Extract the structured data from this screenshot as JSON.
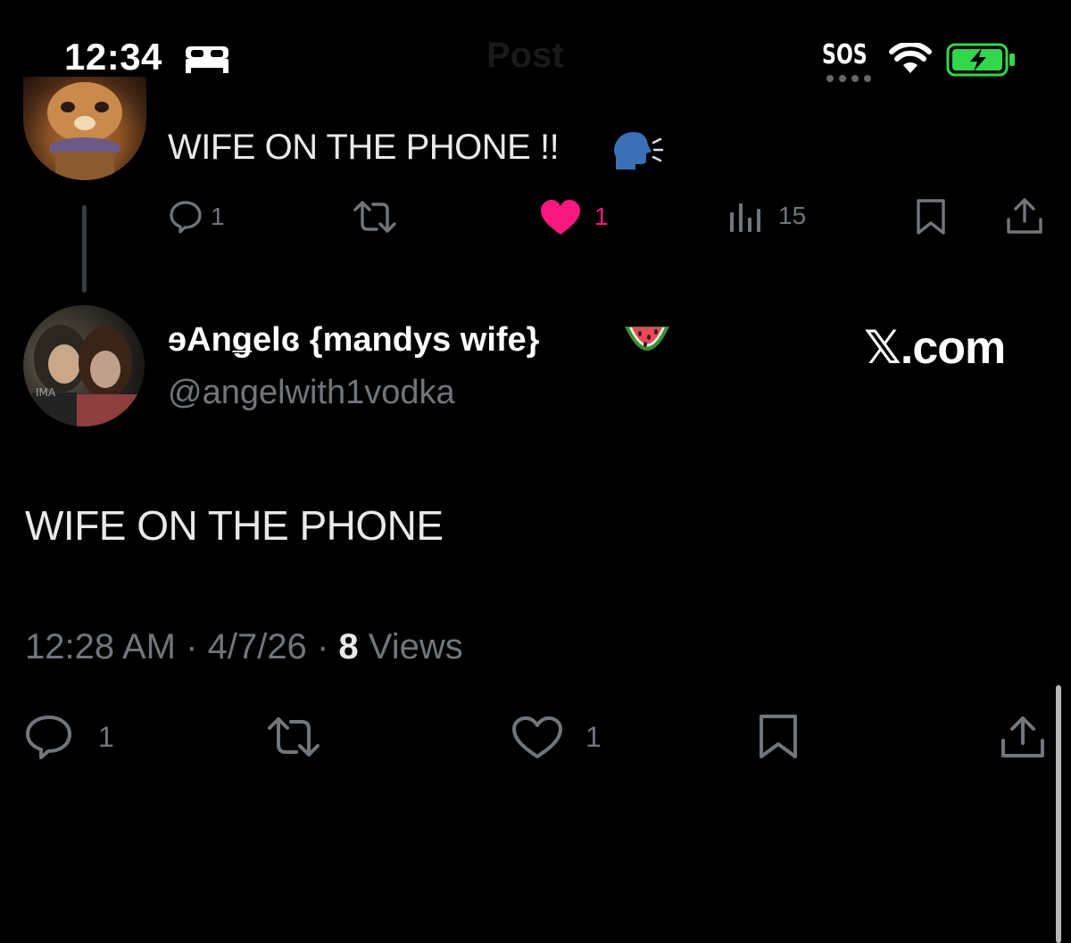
{
  "status_bar": {
    "time": "12:34",
    "screen_title": "Post",
    "carrier_status": "SOS",
    "icons": [
      "bed-icon",
      "signal-dots-icon",
      "wifi-icon",
      "battery-charging-icon"
    ]
  },
  "parent_post": {
    "text": "WIFE ON THE PHONE !!",
    "emoji": "speaking-head-icon",
    "actions": {
      "reply_count": "1",
      "like_count": "1",
      "views_count": "15"
    }
  },
  "main_post": {
    "display_name": "ɘAnǥelɞ {mandys wife}",
    "name_emoji": "watermelon-icon",
    "handle": "@angelwith1vodka",
    "watermark": "𝕏.com",
    "text": "WIFE ON THE PHONE",
    "time": "12:28 AM",
    "date": "4/7/26",
    "views_number": "8",
    "views_label": "Views",
    "separator": "·",
    "actions": {
      "reply_count": "1",
      "like_count": "1"
    }
  },
  "colors": {
    "background": "#000000",
    "text": "#e7e9ea",
    "muted": "#71767b",
    "like_pink": "#f91880",
    "battery_green": "#32d74b"
  }
}
